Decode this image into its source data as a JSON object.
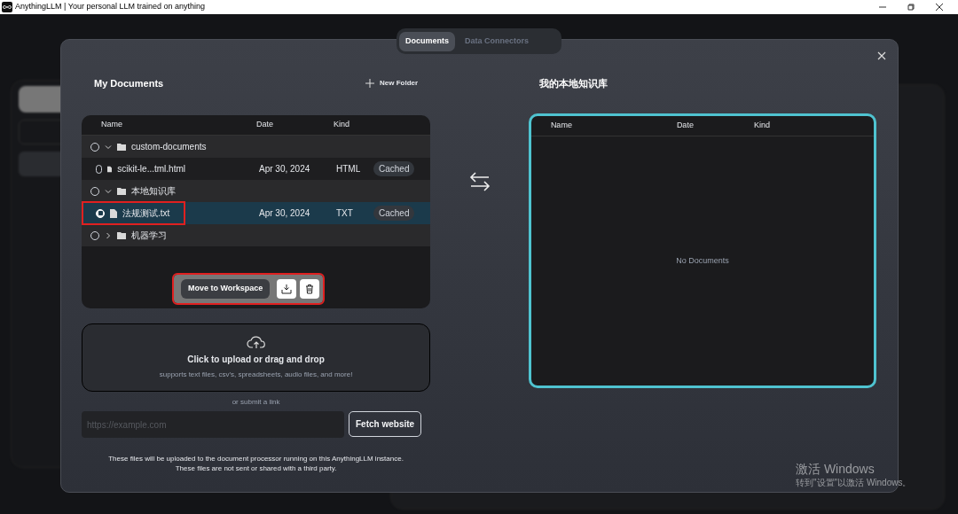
{
  "window": {
    "title": "AnythingLLM | Your personal LLM trained on anything"
  },
  "tabs": [
    {
      "label": "Documents",
      "selected": true
    },
    {
      "label": "Data Connectors",
      "selected": false
    }
  ],
  "my_documents": {
    "title": "My Documents",
    "new_folder": "New Folder",
    "columns": [
      "Name",
      "Date",
      "Kind"
    ],
    "rows": [
      {
        "kind": "folder",
        "name": "custom-documents",
        "expanded": true,
        "checked": false,
        "children": [
          {
            "kind": "file",
            "name": "scikit-le...tml.html",
            "date": "Apr 30, 2024",
            "type": "HTML",
            "badge": "Cached",
            "checked": false,
            "selected": false,
            "highlighted": false
          }
        ]
      },
      {
        "kind": "folder",
        "name": "本地知识库",
        "expanded": true,
        "checked": false,
        "children": [
          {
            "kind": "file",
            "name": "法规测试.txt",
            "date": "Apr 30, 2024",
            "type": "TXT",
            "badge": "Cached",
            "checked": true,
            "selected": true,
            "highlighted": true
          }
        ]
      },
      {
        "kind": "folder",
        "name": "机器学习",
        "expanded": false,
        "checked": false
      }
    ],
    "move_to_workspace": {
      "label": "Move to Workspace",
      "highlighted": true
    }
  },
  "upload": {
    "title": "Click to upload or drag and drop",
    "subtitle": "supports text files, csv's, spreadsheets, audio files, and more!"
  },
  "link": {
    "caption": "or submit a link",
    "placeholder": "https://example.com",
    "button": "Fetch website"
  },
  "disclaimer": [
    "These files will be uploaded to the document processor running on this AnythingLLM instance.",
    "These files are not sent or shared with a third party."
  ],
  "workspace": {
    "title": "我的本地知识库",
    "columns": [
      "Name",
      "Date",
      "Kind"
    ],
    "empty": "No Documents"
  },
  "activation_notice": [
    "激活 Windows",
    "转到\"设置\"以激活 Windows。"
  ]
}
